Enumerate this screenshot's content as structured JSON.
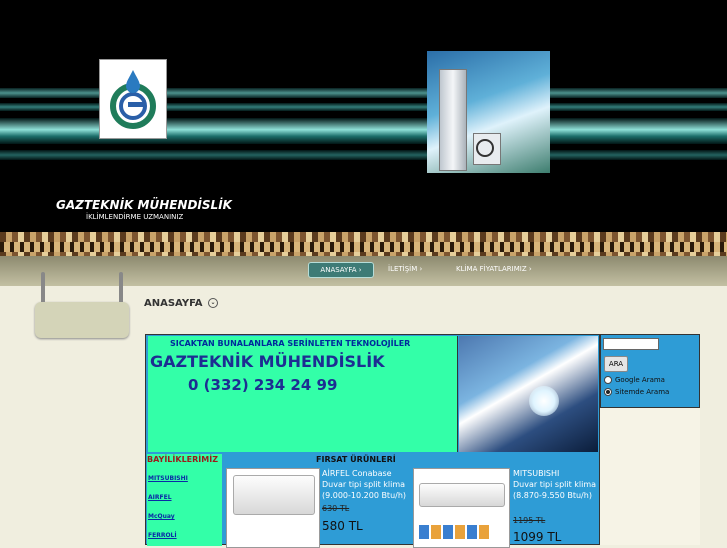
{
  "header": {
    "brand": "GAZTEKNİK MÜHENDİSLİK",
    "tagline": "İKLİMLENDİRME UZMANINIZ",
    "logo_icon": "gd-logo-icon",
    "ac_image_icon": "air-conditioner-icon"
  },
  "nav": {
    "items": [
      {
        "label": "ANASAYFA"
      },
      {
        "label": "İLETİŞİM"
      },
      {
        "label": "KLİMA FİYATLARIMIZ"
      }
    ]
  },
  "page": {
    "heading": "ANASAYFA"
  },
  "hero": {
    "subtitle": "SICAKTAN BUNALANLARA SERİNLETEN TEKNOLOJİLER",
    "title": "GAZTEKNİK MÜHENDİSLİK",
    "phone": "0 (332) 234 24 99"
  },
  "dealers": {
    "heading": "BAYİLİKLERİMİZ :",
    "items": [
      "MITSUBISHI",
      "AIRFEL",
      "McQuay",
      "FERROLİ"
    ]
  },
  "deals": {
    "heading": "FIRSAT ÜRÜNLERİ",
    "products": [
      {
        "brand": "AİRFEL  Conabase",
        "desc1": "Duvar tipi split klima",
        "desc2": "(9.000-10.200 Btu/h)",
        "old_price": "630 TL",
        "new_price": "580 TL"
      },
      {
        "brand": "MITSUBISHI",
        "desc1": "Duvar tipi split klima",
        "desc2": "(8.870-9.550 Btu/h)",
        "old_price": "1195 TL",
        "new_price": "1099 TL"
      }
    ]
  },
  "search": {
    "button": "ARA",
    "options": [
      {
        "label": "Google Arama",
        "selected": false
      },
      {
        "label": "Sitemde Arama",
        "selected": true
      }
    ]
  },
  "colors": {
    "hero_green": "#33ffa8",
    "content_blue": "#2e9cd6",
    "title_navy": "#1d2d92",
    "page_bg": "#f0eedf"
  }
}
